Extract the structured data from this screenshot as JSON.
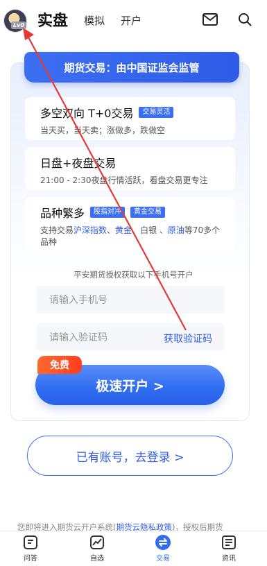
{
  "header": {
    "avatar_level": "Lv0",
    "tabs": [
      "实盘",
      "模拟",
      "开户"
    ],
    "icons": [
      "mail-icon",
      "search-icon"
    ]
  },
  "banner": {
    "text": "期货交易：由中国证监会监管"
  },
  "features": [
    {
      "title": "多空双向  T+0交易",
      "tag": "交易灵活",
      "desc": "当天买，当天卖；涨做多，跌做空"
    },
    {
      "title": "日盘+夜盘交易",
      "desc": "21:00 - 2:30夜盘行情活跃，看盘交易更专注"
    },
    {
      "title": "品种繁多",
      "tags": [
        "股指对冲",
        "黄金交易"
      ],
      "desc_parts": [
        "支持交易",
        "沪深指数",
        "、",
        "黄金",
        "、白银 、",
        "原油",
        "等70多个品种"
      ]
    }
  ],
  "form": {
    "auth_note": "平安期货授权获取以下手机号开户",
    "phone_placeholder": "请输入手机号",
    "code_placeholder": "请输入验证码",
    "get_code_label": "获取验证码",
    "free_badge": "免费",
    "open_button": "极速开户 >"
  },
  "login_button": "已有账号，去登录 >",
  "privacy": {
    "prefix": "您即将进入期货云开户系统(",
    "link": "期货云隐私政策",
    "suffix": ")，授权后期货"
  },
  "bottom_nav": [
    {
      "label": "问答",
      "icon": "qa-icon"
    },
    {
      "label": "自选",
      "icon": "watchlist-icon"
    },
    {
      "label": "交易",
      "icon": "trade-icon",
      "active": true
    },
    {
      "label": "资讯",
      "icon": "news-icon"
    }
  ],
  "colors": {
    "accent": "#2f6cf0",
    "badge": "#ff4a24",
    "annotation_arrow": "#e53935"
  }
}
